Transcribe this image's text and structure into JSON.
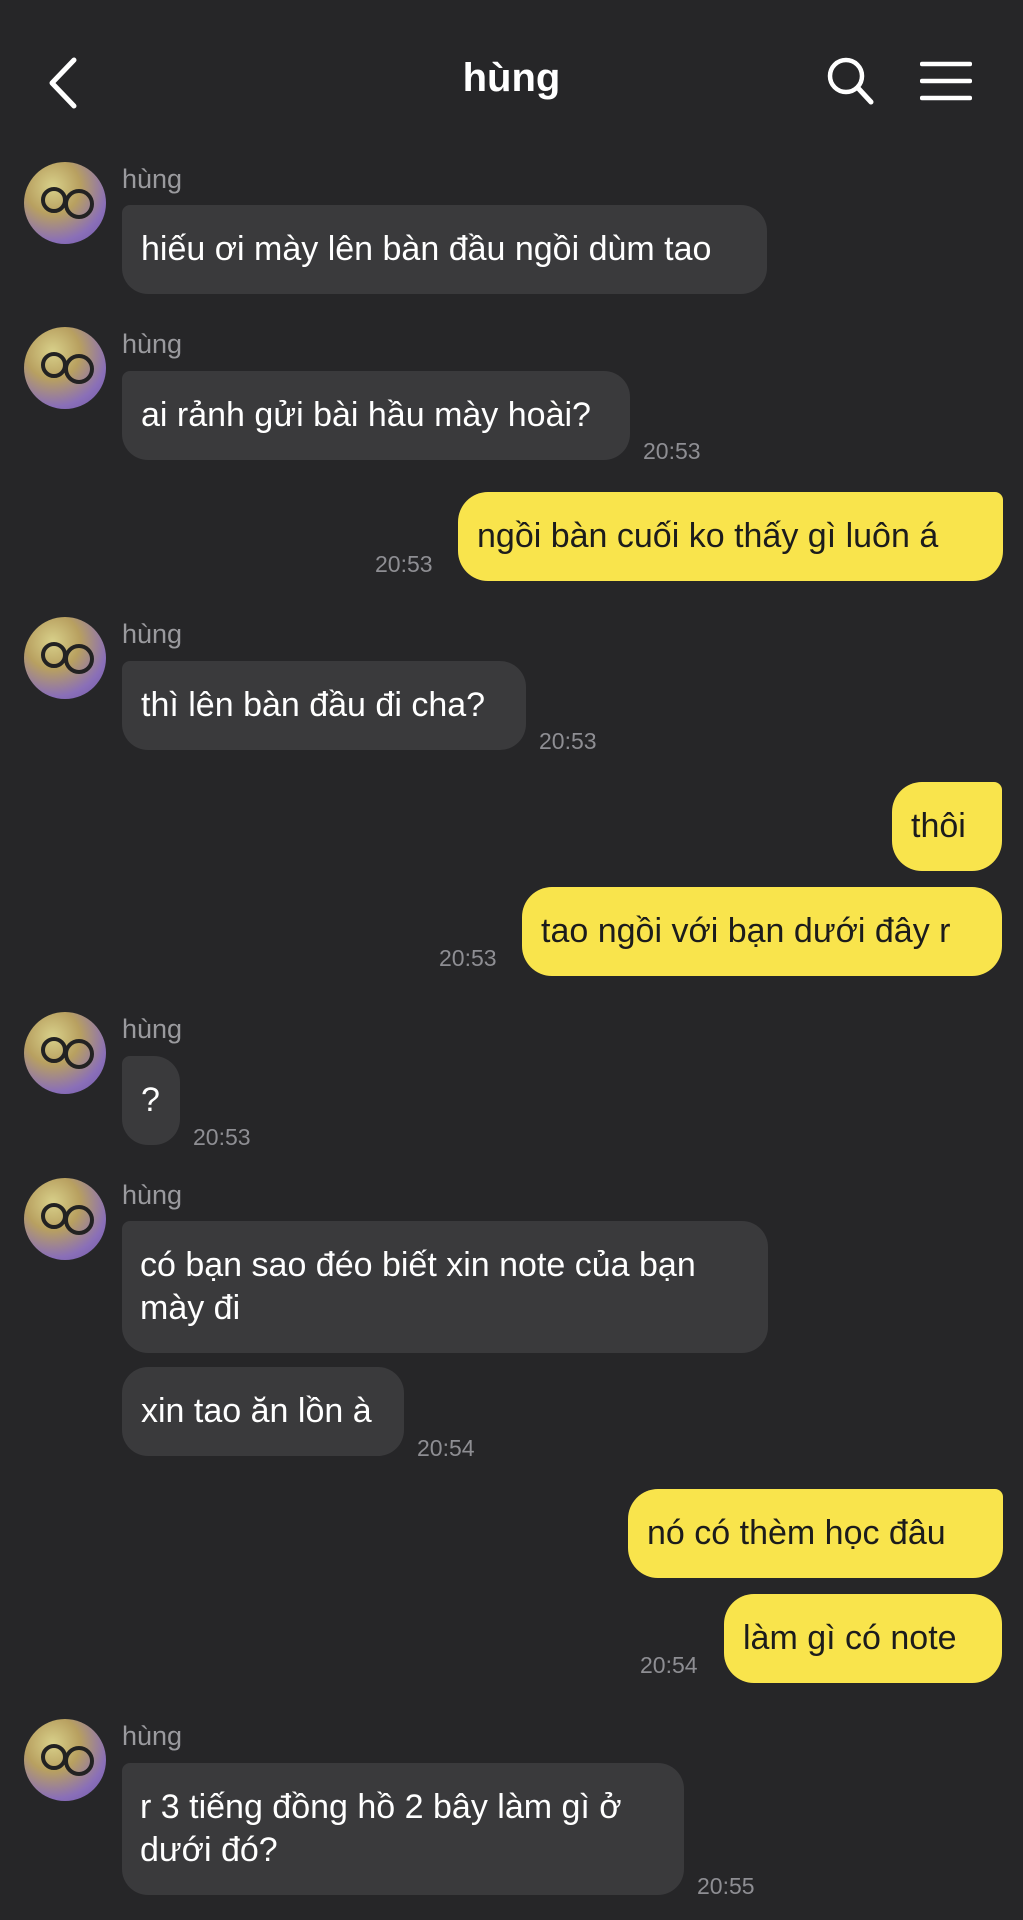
{
  "header": {
    "title": "hùng",
    "back_icon": "chevron-left-icon",
    "search_icon": "search-icon",
    "menu_icon": "hamburger-menu-icon"
  },
  "colors": {
    "background": "#262628",
    "incoming_bubble": "#3a3a3c",
    "outgoing_bubble": "#f9e44c",
    "timestamp": "#8e8e93"
  },
  "messages": [
    {
      "sender": "hùng",
      "text": "hiếu ơi mày lên bàn đầu ngồi dùm tao",
      "time": ""
    },
    {
      "sender": "hùng",
      "text": "ai rảnh gửi bài hầu mày hoài?",
      "time": "20:53"
    },
    {
      "sender": "me",
      "text": "ngồi bàn cuối ko thấy gì luôn á",
      "time": "20:53"
    },
    {
      "sender": "hùng",
      "text": "thì lên bàn đầu đi cha?",
      "time": "20:53"
    },
    {
      "sender": "me",
      "text": "thôi",
      "time": ""
    },
    {
      "sender": "me",
      "text": "tao ngồi với bạn dưới đây r",
      "time": "20:53"
    },
    {
      "sender": "hùng",
      "text": "?",
      "time": "20:53"
    },
    {
      "sender": "hùng",
      "text": "có bạn sao đéo biết xin note của bạn mày đi",
      "time": ""
    },
    {
      "sender": "hùng",
      "text": "xin tao ăn lồn à",
      "time": "20:54"
    },
    {
      "sender": "me",
      "text": "nó có thèm học đâu",
      "time": ""
    },
    {
      "sender": "me",
      "text": "làm gì có note",
      "time": "20:54"
    },
    {
      "sender": "hùng",
      "text": "r 3 tiếng đồng hồ 2 bây làm gì ở dưới đó?",
      "time": "20:55"
    }
  ]
}
